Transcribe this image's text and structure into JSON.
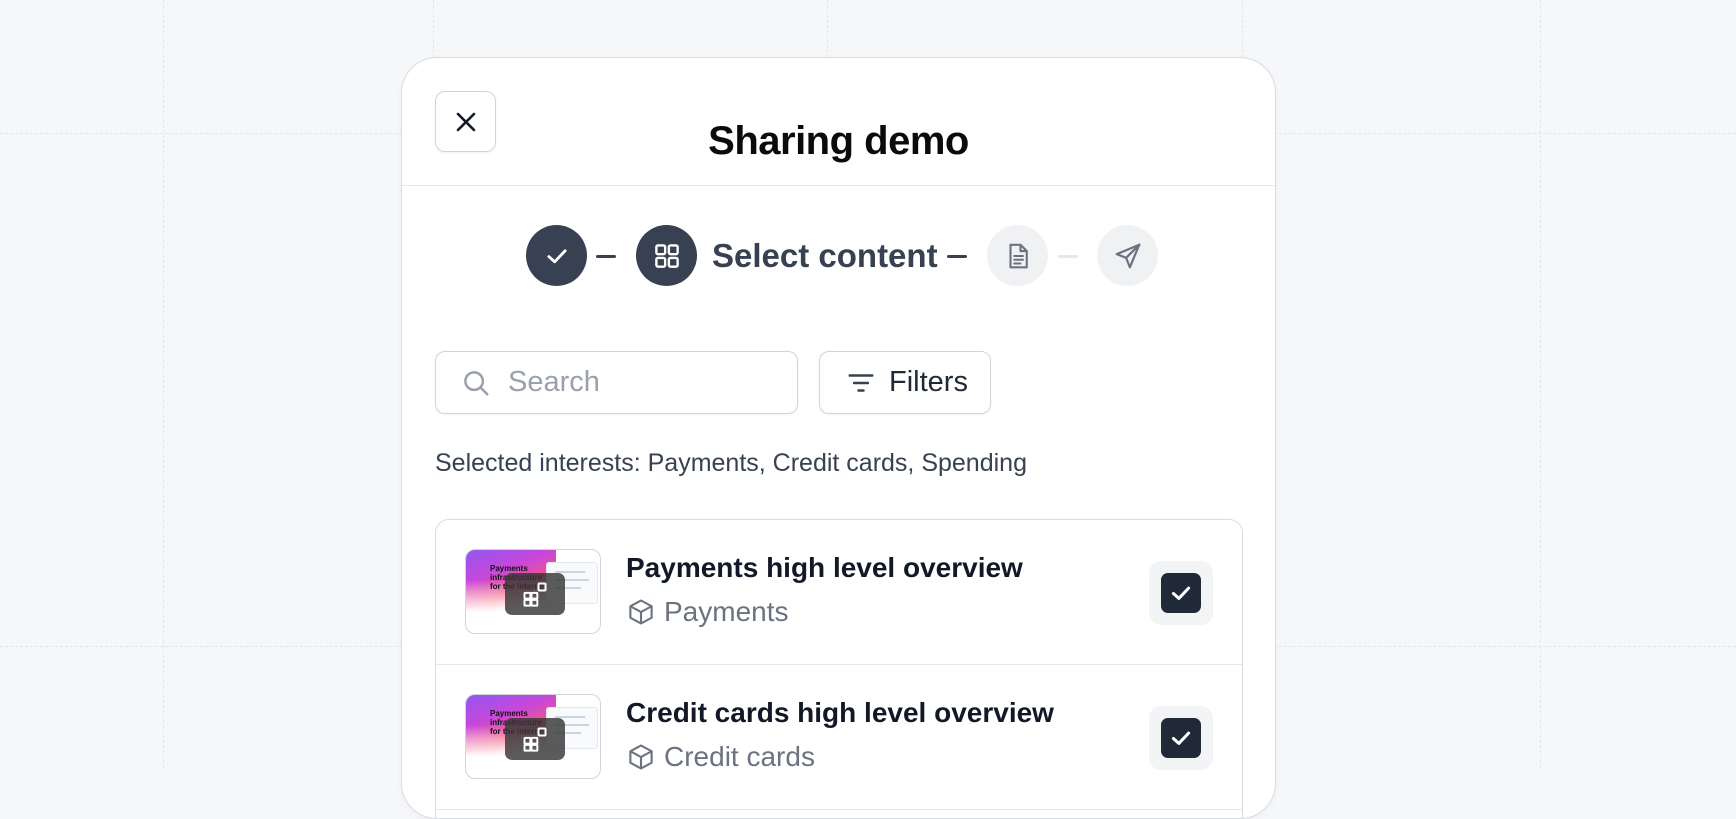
{
  "dialog": {
    "title": "Sharing demo"
  },
  "stepper": {
    "current_label": "Select content",
    "steps": [
      {
        "icon": "check-icon",
        "state": "done"
      },
      {
        "icon": "grid-icon",
        "state": "active",
        "label": "Select content"
      },
      {
        "icon": "document-icon",
        "state": "pending"
      },
      {
        "icon": "send-icon",
        "state": "pending"
      }
    ]
  },
  "search": {
    "placeholder": "Search",
    "value": ""
  },
  "filters": {
    "label": "Filters"
  },
  "interests": {
    "text": "Selected interests: Payments, Credit cards, Spending"
  },
  "items": [
    {
      "title": "Payments high level overview",
      "category": "Payments",
      "checked": true,
      "thumbnail_text": "Payments infrastructure for the internet"
    },
    {
      "title": "Credit cards high level overview",
      "category": "Credit cards",
      "checked": true,
      "thumbnail_text": "Payments infrastructure for the internet"
    }
  ],
  "colors": {
    "background": "#f6f7f9",
    "primary_dark": "#374151",
    "checkbox": "#1f2937",
    "muted_text": "#6b7280"
  }
}
